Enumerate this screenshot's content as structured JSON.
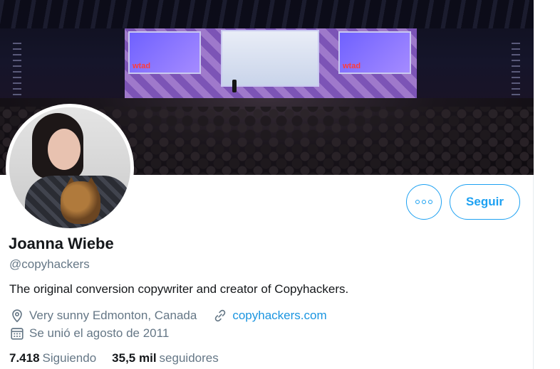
{
  "profile": {
    "name": "Joanna Wiebe",
    "handle": "@copyhackers",
    "bio": "The original conversion copywriter and creator of Copyhackers.",
    "location": "Very sunny Edmonton, Canada",
    "website": "copyhackers.com",
    "joined": "Se unió el agosto de 2011",
    "following_count": "7.418",
    "following_label": "Siguiendo",
    "followers_count": "35,5 mil",
    "followers_label": "seguidores"
  },
  "banner": {
    "screen_brand_left": "wtad",
    "screen_brand_right": "wtad"
  },
  "actions": {
    "follow_label": "Seguir",
    "more_icon": "more-horizontal-icon"
  },
  "icons": {
    "location": "location-pin-icon",
    "link": "link-icon",
    "calendar": "calendar-icon"
  },
  "colors": {
    "accent": "#1da1f2",
    "link": "#1b95e0",
    "text_primary": "#14171a",
    "text_secondary": "#657786"
  }
}
